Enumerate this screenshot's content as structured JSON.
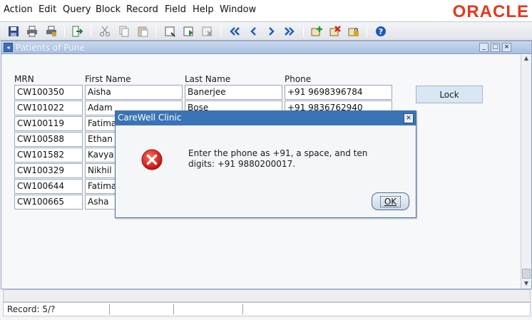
{
  "menu": {
    "items": [
      {
        "label": "Action"
      },
      {
        "label": "Edit"
      },
      {
        "label": "Query"
      },
      {
        "label": "Block"
      },
      {
        "label": "Record"
      },
      {
        "label": "Field"
      },
      {
        "label": "Help"
      },
      {
        "label": "Window"
      }
    ],
    "logo_text": "ORACLE"
  },
  "toolbar": {
    "icons": [
      "save-icon",
      "print-icon",
      "print-setup-icon",
      "exit-icon",
      "cut-icon",
      "copy-icon",
      "paste-icon",
      "enter-query-icon",
      "execute-query-icon",
      "cancel-query-icon",
      "first-record-icon",
      "previous-record-icon",
      "next-record-icon",
      "last-record-icon",
      "insert-record-icon",
      "delete-record-icon",
      "lock-record-icon",
      "help-icon"
    ]
  },
  "window": {
    "title": "Patients of Pune",
    "columns": {
      "mrn": "MRN",
      "first_name": "First Name",
      "last_name": "Last Name",
      "phone": "Phone"
    },
    "rows": [
      {
        "mrn": "CW100350",
        "first_name": "Aisha",
        "last_name": "Banerjee",
        "phone": "+91 9698396784"
      },
      {
        "mrn": "CW101022",
        "first_name": "Adam",
        "last_name": "Bose",
        "phone": "+91 9836762940"
      },
      {
        "mrn": "CW100119",
        "first_name": "Fatima",
        "last_name": "",
        "phone": ""
      },
      {
        "mrn": "CW100588",
        "first_name": "Ethan",
        "last_name": "",
        "phone": ""
      },
      {
        "mrn": "CW101582",
        "first_name": "Kavya",
        "last_name": "",
        "phone": ""
      },
      {
        "mrn": "CW100329",
        "first_name": "Nikhil",
        "last_name": "",
        "phone": ""
      },
      {
        "mrn": "CW100644",
        "first_name": "Fatima",
        "last_name": "",
        "phone": ""
      },
      {
        "mrn": "CW100665",
        "first_name": "Asha",
        "last_name": "",
        "phone": ""
      }
    ],
    "lock_button": "Lock"
  },
  "status": {
    "record": "Record: 5/?"
  },
  "dialog": {
    "title": "CareWell Clinic",
    "message": "Enter the phone as +91, a space, and ten digits: +91 9880200017.",
    "ok_label": "OK",
    "icon": "error-icon",
    "error_color": "#e0201f"
  }
}
